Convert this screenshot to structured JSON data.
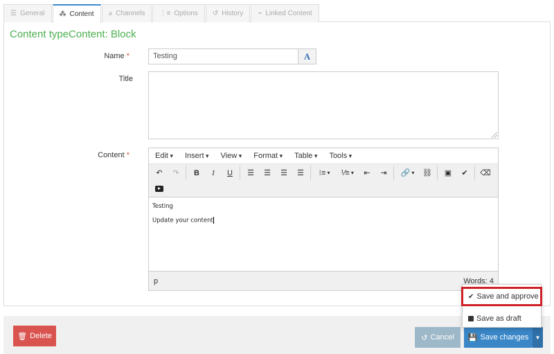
{
  "tabs": [
    {
      "label": "General",
      "icon": "sliders-icon"
    },
    {
      "label": "Content",
      "icon": "cubes-icon"
    },
    {
      "label": "Channels",
      "icon": "channels-icon"
    },
    {
      "label": "Options",
      "icon": "options-icon"
    },
    {
      "label": "History",
      "icon": "history-icon"
    },
    {
      "label": "Linked Content",
      "icon": "link-icon"
    }
  ],
  "content_title": "Content typeContent: Block",
  "form": {
    "name_label": "Name",
    "name_value": "Testing",
    "name_addon": "A",
    "title_label": "Title",
    "content_label": "Content",
    "required_mark": "*"
  },
  "editor": {
    "menus": [
      "Edit",
      "Insert",
      "View",
      "Format",
      "Table",
      "Tools"
    ],
    "lines": [
      "Testing",
      "Update your content"
    ],
    "status_path": "p",
    "word_count": "Words: 4"
  },
  "footer": {
    "delete_label": "Delete",
    "cancel_label": "Cancel",
    "save_label": "Save changes"
  },
  "dropdown": {
    "approve_label": "Save and approve",
    "draft_label": "Save as draft"
  },
  "colors": {
    "title_green": "#4caf50",
    "primary": "#3a87c8",
    "danger": "#d9534f",
    "highlight": "#d02027"
  }
}
